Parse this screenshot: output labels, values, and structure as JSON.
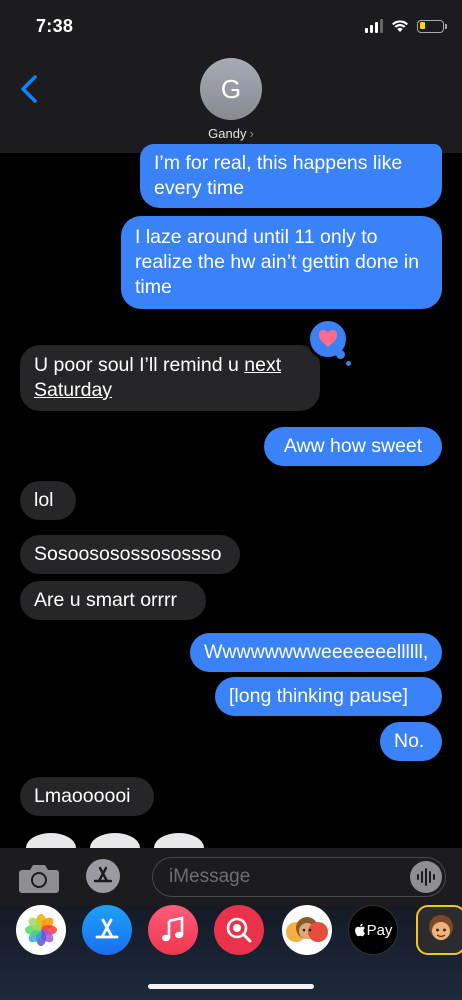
{
  "status": {
    "time": "7:38"
  },
  "contact": {
    "initial": "G",
    "name": "Gandy",
    "chevron": "›"
  },
  "messages": [
    {
      "from": "me",
      "text": "I’m for real, this happens like every time"
    },
    {
      "from": "me",
      "text": "I laze around until 11 only to realize the hw ain’t gettin done in time"
    },
    {
      "from": "them",
      "text_before": "U poor soul I’ll remind u ",
      "text_link": "next Saturday",
      "reaction": "heart"
    },
    {
      "from": "me",
      "text": "Aww how sweet"
    },
    {
      "from": "them",
      "text": "lol"
    },
    {
      "from": "them",
      "text": "Sosoososossosossso"
    },
    {
      "from": "them",
      "text": "Are u smart orrrr"
    },
    {
      "from": "me",
      "text": "Wwwwwwwweeeeeeellllll,"
    },
    {
      "from": "me",
      "text": "[long thinking pause]"
    },
    {
      "from": "me",
      "text": "No."
    },
    {
      "from": "them",
      "text": "Lmaoooooi"
    }
  ],
  "composer": {
    "placeholder": "iMessage"
  },
  "app_drawer": {
    "apps": [
      {
        "name": "Photos",
        "icon": "photos-icon"
      },
      {
        "name": "App Store",
        "icon": "app-store-icon"
      },
      {
        "name": "Music",
        "icon": "music-icon"
      },
      {
        "name": "Images",
        "icon": "image-search-icon"
      },
      {
        "name": "Memoji Stickers",
        "icon": "memoji-stickers-icon"
      },
      {
        "name": "Apple Pay",
        "icon": "apple-pay-icon",
        "label": "Pay"
      },
      {
        "name": "Memoji",
        "icon": "memoji-icon"
      }
    ]
  },
  "colors": {
    "sent": "#3a82f7",
    "received": "#262629",
    "accent": "#0a84ff",
    "reaction": "#ff6b8b"
  }
}
